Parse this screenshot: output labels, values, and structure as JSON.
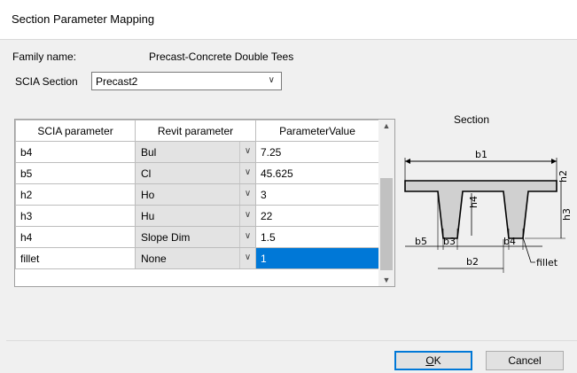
{
  "dialog": {
    "title": "Section Parameter Mapping"
  },
  "family": {
    "label": "Family name:",
    "value": "Precast-Concrete Double Tees"
  },
  "scia_section": {
    "label": "SCIA Section",
    "value": "Precast2"
  },
  "grid": {
    "headers": [
      "SCIA parameter",
      "Revit parameter",
      "ParameterValue"
    ],
    "rows": [
      {
        "scia": "b4",
        "revit": "Bul",
        "value": "7.25"
      },
      {
        "scia": "b5",
        "revit": "Cl",
        "value": "45.625"
      },
      {
        "scia": "h2",
        "revit": "Ho",
        "value": "3"
      },
      {
        "scia": "h3",
        "revit": "Hu",
        "value": "22"
      },
      {
        "scia": "h4",
        "revit": "Slope Dim",
        "value": "1.5"
      },
      {
        "scia": "fillet",
        "revit": "None",
        "value": "1",
        "selected": true
      }
    ]
  },
  "section_panel": {
    "title": "Section",
    "dims": {
      "b1": "b1",
      "h2": "h2",
      "h3": "h3",
      "h4": "h4",
      "b5": "b5",
      "b3": "b3",
      "b2": "b2",
      "b4": "b4",
      "fillet": "fillet"
    }
  },
  "buttons": {
    "ok_prefix": "O",
    "ok_rest": "K",
    "cancel": "Cancel"
  }
}
